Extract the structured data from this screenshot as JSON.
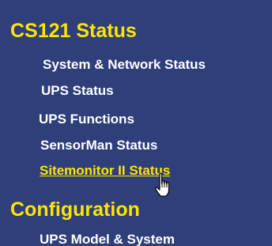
{
  "sections": [
    {
      "title": "CS121 Status",
      "items": [
        {
          "label": "System & Network Status"
        },
        {
          "label": "UPS Status"
        },
        {
          "label": "UPS Functions"
        },
        {
          "label": "SensorMan Status"
        },
        {
          "label": "Sitemonitor II Status",
          "active": true
        }
      ]
    },
    {
      "title": "Configuration",
      "items": [
        {
          "label": "UPS Model & System"
        }
      ]
    }
  ],
  "colors": {
    "background": "#2e3f7a",
    "heading": "#ffe400",
    "link": "#ffffff",
    "active_link": "#ffe400"
  },
  "cursor": "hand-pointer-icon"
}
